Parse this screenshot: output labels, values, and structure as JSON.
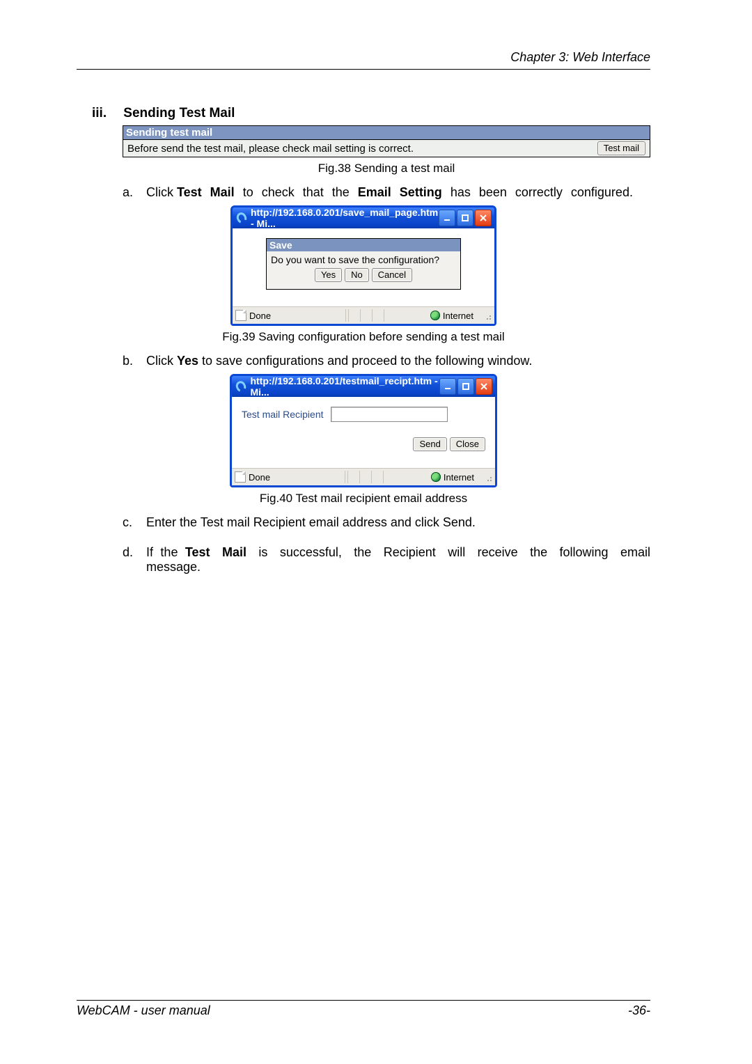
{
  "chapter_header": "Chapter 3: Web Interface",
  "section": {
    "number": "iii.",
    "title": "Sending Test Mail"
  },
  "fig38": {
    "titlebar": "Sending test mail",
    "body_text": "Before send the test mail, please check mail setting is correct.",
    "button_label": "Test mail",
    "caption": "Fig.38  Sending a test mail"
  },
  "step_a": {
    "marker": "a.",
    "pre": "Click ",
    "bold1": "Test Mail",
    "mid": " to check that the ",
    "bold2": "Email Setting",
    "post": " has been correctly configured."
  },
  "fig39": {
    "url": "http://192.168.0.201/save_mail_page.htm - Mi...",
    "save_title": "Save",
    "save_question": "Do you want to save the configuration?",
    "yes": "Yes",
    "no": "No",
    "cancel": "Cancel",
    "status_done": "Done",
    "status_zone": "Internet",
    "caption": "Fig.39  Saving configuration before sending a test mail"
  },
  "step_b": {
    "marker": "b.",
    "pre": "Click ",
    "bold": "Yes",
    "post": " to save configurations and proceed to the following window."
  },
  "fig40": {
    "url": "http://192.168.0.201/testmail_recipt.htm - Mi...",
    "label": "Test mail Recipient",
    "send": "Send",
    "close": "Close",
    "status_done": "Done",
    "status_zone": "Internet",
    "caption": "Fig.40  Test mail recipient email address"
  },
  "step_c": {
    "marker": "c.",
    "text": "Enter the Test mail Recipient email address and click Send."
  },
  "step_d": {
    "marker": "d.",
    "pre": "If the ",
    "bold": "Test Mail",
    "post": " is successful, the Recipient will receive the following email message."
  },
  "footer_left": "WebCAM - user manual",
  "footer_right": "-36-"
}
